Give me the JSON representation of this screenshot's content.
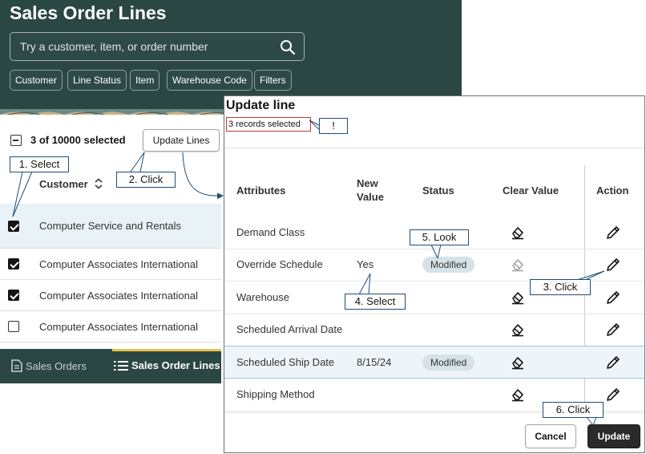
{
  "header": {
    "title": "Sales Order Lines",
    "search_placeholder": "Try a customer, item, or order number",
    "filters": [
      "Customer",
      "Line Status",
      "Item",
      "Warehouse Code",
      "Filters"
    ]
  },
  "list": {
    "selected_count": "3 of 10000 selected",
    "update_lines_label": "Update Lines",
    "column_customer": "Customer",
    "rows": [
      {
        "name": "Computer Service and Rentals",
        "checked": true
      },
      {
        "name": "Computer Associates International",
        "checked": true
      },
      {
        "name": "Computer Associates International",
        "checked": true
      },
      {
        "name": "Computer Associates International",
        "checked": false
      }
    ]
  },
  "bottom_nav": {
    "sales_orders": "Sales Orders",
    "sales_order_lines": "Sales Order Lines"
  },
  "dialog": {
    "title": "Update line",
    "records_selected": "3 records selected",
    "columns": {
      "attributes": "Attributes",
      "new_value_1": "New",
      "new_value_2": "Value",
      "status": "Status",
      "clear_value": "Clear Value",
      "action": "Action"
    },
    "rows": [
      {
        "attribute": "Demand Class",
        "value": "",
        "status": ""
      },
      {
        "attribute": "Override Schedule",
        "value": "Yes",
        "status": "Modified"
      },
      {
        "attribute": "Warehouse",
        "value": "",
        "status": ""
      },
      {
        "attribute": "Scheduled Arrival Date",
        "value": "",
        "status": ""
      },
      {
        "attribute": "Scheduled Ship Date",
        "value": "8/15/24",
        "status": "Modified"
      },
      {
        "attribute": "Shipping Method",
        "value": "",
        "status": ""
      }
    ],
    "cancel_label": "Cancel",
    "update_label": "Update"
  },
  "callouts": {
    "c1": "1. Select",
    "c2": "2. Click",
    "c3": "3. Click",
    "c4": "4. Select",
    "c5": "5. Look",
    "c6": "6. Click",
    "bang": "!"
  },
  "colors": {
    "header_bg": "#2b4744",
    "accent_bar": "#e6c34d",
    "callout_border": "#1f4e79",
    "badge_bg": "#d5e3e8",
    "highlight_row": "#eef5fa"
  }
}
